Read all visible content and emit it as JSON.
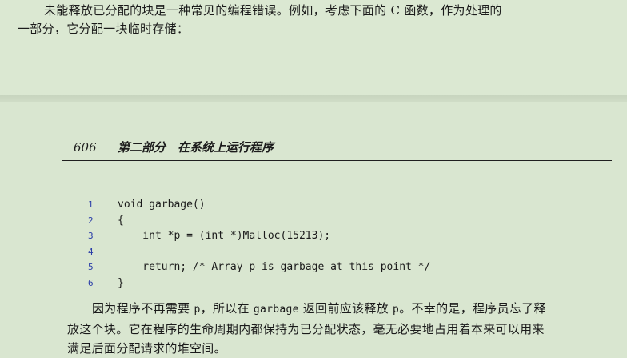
{
  "top_paragraph": {
    "line1": "未能释放已分配的块是一种常见的编程错误。例如，考虑下面的 C 函数，作为处理的",
    "line2": "一部分，它分配一块临时存储："
  },
  "running_header": {
    "page_number": "606",
    "chapter_title": "第二部分　在系统上运行程序"
  },
  "code_listing": [
    {
      "num": "1",
      "text": "void garbage()"
    },
    {
      "num": "2",
      "text": "{"
    },
    {
      "num": "3",
      "text": "    int *p = (int *)Malloc(15213);"
    },
    {
      "num": "4",
      "text": ""
    },
    {
      "num": "5",
      "text": "    return; /* Array p is garbage at this point */"
    },
    {
      "num": "6",
      "text": "}"
    }
  ],
  "bottom_paragraph": {
    "line1_a": "因为程序不再需要 ",
    "line1_code1": "p",
    "line1_b": "，所以在 ",
    "line1_code2": "garbage",
    "line1_c": " 返回前应该释放 ",
    "line1_code3": "p",
    "line1_d": "。不幸的是，程序员忘了释",
    "line2": "放这个块。它在程序的生命周期内都保持为已分配状态，毫无必要地占用着本来可以用来",
    "line3": "满足后面分配请求的堆空间。"
  }
}
